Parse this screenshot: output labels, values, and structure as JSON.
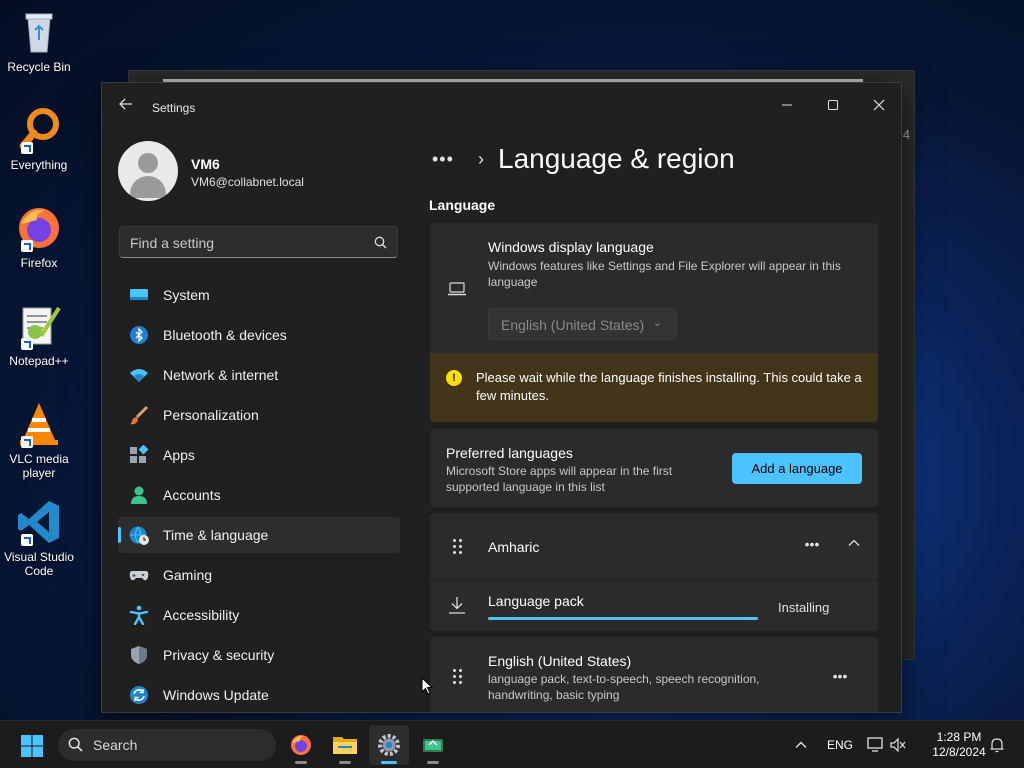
{
  "desktop": {
    "icons": [
      {
        "label": "Recycle Bin",
        "icon": "recycle-bin-icon"
      },
      {
        "label": "Everything",
        "icon": "everything-search-icon"
      },
      {
        "label": "Firefox",
        "icon": "firefox-icon"
      },
      {
        "label": "Notepad++",
        "icon": "notepad-plus-plus-icon"
      },
      {
        "label": "VLC media player",
        "icon": "vlc-icon"
      },
      {
        "label": "Visual Studio Code",
        "icon": "vscode-icon"
      }
    ],
    "background_window_number": "4"
  },
  "window": {
    "title": "Settings",
    "minimize": "—",
    "maximize": "▢",
    "close": "✕"
  },
  "profile": {
    "name": "VM6",
    "email": "VM6@collabnet.local"
  },
  "search": {
    "placeholder": "Find a setting"
  },
  "nav": {
    "items": [
      {
        "label": "System",
        "icon": "monitor-icon"
      },
      {
        "label": "Bluetooth & devices",
        "icon": "bluetooth-icon"
      },
      {
        "label": "Network & internet",
        "icon": "wifi-icon"
      },
      {
        "label": "Personalization",
        "icon": "brush-icon"
      },
      {
        "label": "Apps",
        "icon": "apps-icon"
      },
      {
        "label": "Accounts",
        "icon": "person-icon"
      },
      {
        "label": "Time & language",
        "icon": "globe-clock-icon",
        "active": true
      },
      {
        "label": "Gaming",
        "icon": "gamepad-icon"
      },
      {
        "label": "Accessibility",
        "icon": "accessibility-icon"
      },
      {
        "label": "Privacy & security",
        "icon": "shield-icon"
      },
      {
        "label": "Windows Update",
        "icon": "update-icon"
      }
    ]
  },
  "content": {
    "breadcrumb_more": "•••",
    "breadcrumb_sep": "›",
    "page_title": "Language & region",
    "section_title": "Language",
    "display_language": {
      "title": "Windows display language",
      "description": "Windows features like Settings and File Explorer will appear in this language",
      "selected": "English (United States)",
      "chevron": "⌄"
    },
    "warning": {
      "icon_glyph": "!",
      "text": "Please wait while the language finishes installing. This could take a few minutes."
    },
    "preferred": {
      "title": "Preferred languages",
      "description": "Microsoft Store apps will appear in the first supported language in this list",
      "add_button": "Add a language"
    },
    "languages": [
      {
        "name": "Amharic",
        "more": "•••",
        "expand": "⌃",
        "pack": {
          "label": "Language pack",
          "status": "Installing",
          "progress": 1.0
        }
      },
      {
        "name": "English (United States)",
        "description": "language pack, text-to-speech, speech recognition, handwriting, basic typing",
        "more": "•••"
      }
    ]
  },
  "taskbar": {
    "search_label": "Search",
    "apps": [
      {
        "name": "firefox-taskbar-icon"
      },
      {
        "name": "file-explorer-taskbar-icon"
      },
      {
        "name": "settings-taskbar-icon",
        "active": true
      },
      {
        "name": "remote-app-taskbar-icon"
      }
    ],
    "tray": {
      "chevron": "⌃",
      "language": "ENG",
      "time": "1:28 PM",
      "date": "12/8/2024"
    }
  },
  "colors": {
    "accent": "#4cc2ff",
    "warning_bg": "#433519",
    "warning_icon": "#fce100"
  }
}
